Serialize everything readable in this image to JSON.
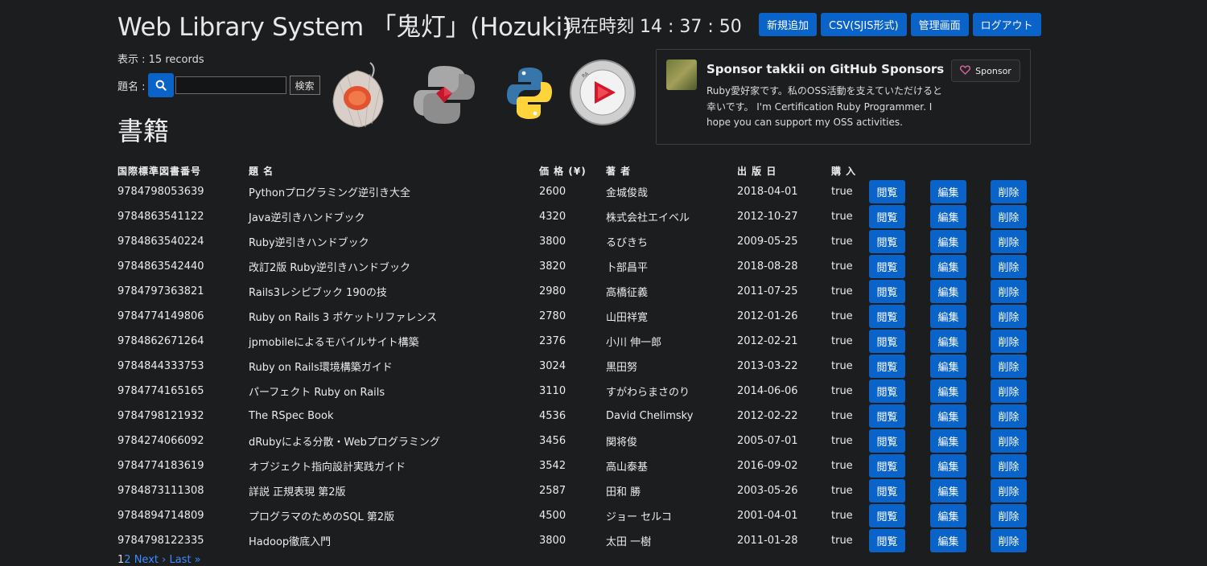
{
  "header": {
    "title": "Web Library System 「鬼灯」(Hozuki)",
    "clock": "現在時刻 14 : 37 : 50",
    "buttons": [
      "新規追加",
      "CSV(SJIS形式)",
      "管理画面",
      "ログアウト"
    ]
  },
  "record_count": "表示 : 15 records",
  "search": {
    "label": "題名 :",
    "value": "",
    "submit": "検索",
    "icon": "search-icon"
  },
  "section_title": "書籍",
  "logos": [
    "hozuki-lantern-logo",
    "ruby-python-logo",
    "python-logo",
    "ruby-certified-logo"
  ],
  "sponsor": {
    "title": "Sponsor takkii on GitHub Sponsors",
    "text": "Ruby愛好家です。私のOSS活動を支えていただけると幸いです。 I'm Certification Ruby Programmer. I hope you can support my OSS activities.",
    "button": "Sponsor",
    "icon": "heart-icon"
  },
  "table": {
    "headers": [
      "国際標準図書番号",
      "題 名",
      "価 格 (¥)",
      "著 者",
      "出 版 日",
      "購 入"
    ],
    "action_labels": [
      "閲覧",
      "編集",
      "削除"
    ],
    "rows": [
      [
        "9784798053639",
        "Pythonプログラミング逆引き大全",
        "2600",
        "金城俊哉",
        "2018-04-01",
        "true"
      ],
      [
        "9784863541122",
        "Java逆引きハンドブック",
        "4320",
        "株式会社エイベル",
        "2012-10-27",
        "true"
      ],
      [
        "9784863540224",
        "Ruby逆引きハンドブック",
        "3800",
        "るびきち",
        "2009-05-25",
        "true"
      ],
      [
        "9784863542440",
        "改訂2版 Ruby逆引きハンドブック",
        "3820",
        "卜部昌平",
        "2018-08-28",
        "true"
      ],
      [
        "9784797363821",
        "Rails3レシピブック 190の技",
        "2980",
        "高橋征義",
        "2011-07-25",
        "true"
      ],
      [
        "9784774149806",
        "Ruby on Rails 3 ポケットリファレンス",
        "2780",
        "山田祥寛",
        "2012-01-26",
        "true"
      ],
      [
        "9784862671264",
        "jpmobileによるモバイルサイト構築",
        "2376",
        "小川 伸一郎",
        "2012-02-21",
        "true"
      ],
      [
        "9784844333753",
        "Ruby on Rails環境構築ガイド",
        "3024",
        "黒田努",
        "2013-03-22",
        "true"
      ],
      [
        "9784774165165",
        "パーフェクト Ruby on Rails",
        "3110",
        "すがわらまさのり",
        "2014-06-06",
        "true"
      ],
      [
        "9784798121932",
        "The RSpec Book",
        "4536",
        "David Chelimsky",
        "2012-02-22",
        "true"
      ],
      [
        "9784274066092",
        "dRubyによる分散・Webプログラミング",
        "3456",
        "関将俊",
        "2005-07-01",
        "true"
      ],
      [
        "9784774183619",
        "オブジェクト指向設計実践ガイド",
        "3542",
        "高山泰基",
        "2016-09-02",
        "true"
      ],
      [
        "9784873111308",
        "詳説 正規表現 第2版",
        "2587",
        "田和 勝",
        "2003-05-26",
        "true"
      ],
      [
        "9784894714809",
        "プログラマのためのSQL 第2版",
        "4500",
        "ジョー セルコ",
        "2001-04-01",
        "true"
      ],
      [
        "9784798122335",
        "Hadoop徹底入門",
        "3800",
        "太田 一樹",
        "2011-01-28",
        "true"
      ]
    ]
  },
  "pagination": {
    "current": "1",
    "page2": "2",
    "next": "Next ›",
    "last": "Last »"
  }
}
